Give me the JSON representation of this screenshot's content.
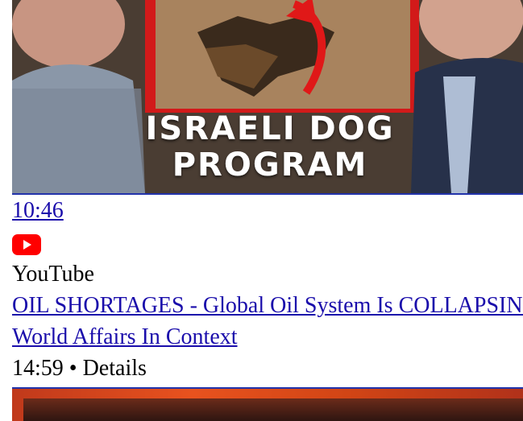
{
  "video1": {
    "thumbnail_line1": "ISRAELI DOG",
    "thumbnail_line2": "PROGRAM",
    "duration": "10:46"
  },
  "youtube_icon": "youtube-icon",
  "source_label": "YouTube",
  "video2": {
    "title": "OIL SHORTAGES - Global Oil System Is COLLAPSING",
    "channel": "World Affairs In Context",
    "meta": "14:59 • Details"
  },
  "colors": {
    "link": "#1a0dab",
    "youtube_red": "#ff0000"
  }
}
